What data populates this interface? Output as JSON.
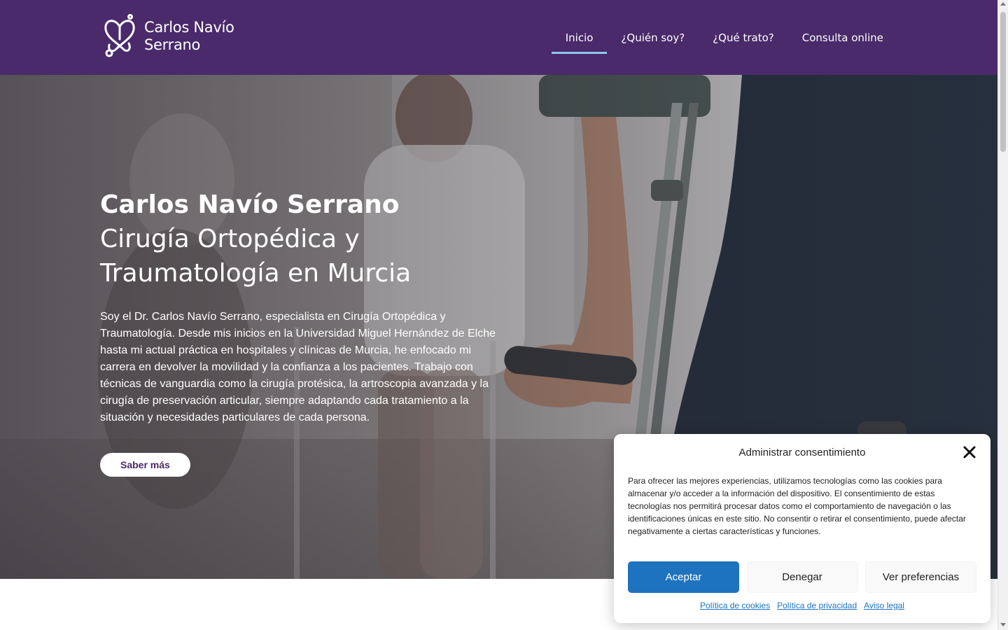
{
  "header": {
    "logo_line1": "Carlos Navío",
    "logo_line2": "Serrano",
    "nav": [
      {
        "label": "Inicio"
      },
      {
        "label": "¿Quién soy?"
      },
      {
        "label": "¿Qué trato?"
      },
      {
        "label": "Consulta online"
      }
    ],
    "colors": {
      "background": "#4a2a6a",
      "active_underline": "#8ec6f0"
    }
  },
  "hero": {
    "title": "Carlos Navío Serrano",
    "subtitle_line1": "Cirugía Ortopédica y",
    "subtitle_line2": "Traumatología en Murcia",
    "text": "Soy el Dr. Carlos Navío Serrano, especialista en Cirugía Ortopédica y Traumatología. Desde mis inicios en la Universidad Miguel Hernández de Elche hasta mi actual práctica en hospitales y clínicas de Murcia, he enfocado mi carrera en devolver la movilidad y la confianza a los pacientes. Trabajo con técnicas de vanguardia como la cirugía protésica, la artroscopia avanzada y la cirugía de preservación articular, siempre adaptando cada tratamiento a la situación y necesidades particulares de cada persona.",
    "button_label": "Saber más"
  },
  "consent": {
    "title": "Administrar consentimiento",
    "body": "Para ofrecer las mejores experiencias, utilizamos tecnologías como las cookies para almacenar y/o acceder a la información del dispositivo. El consentimiento de estas tecnologías nos permitirá procesar datos como el comportamiento de navegación o las identificaciones únicas en este sitio. No consentir o retirar el consentimiento, puede afectar negativamente a ciertas características y funciones.",
    "accept_label": "Aceptar",
    "deny_label": "Denegar",
    "prefs_label": "Ver preferencias",
    "links": [
      {
        "label": "Política de cookies"
      },
      {
        "label": "Política de privacidad"
      },
      {
        "label": "Aviso legal"
      }
    ],
    "colors": {
      "accept": "#1e73be",
      "link": "#1e73be"
    }
  }
}
